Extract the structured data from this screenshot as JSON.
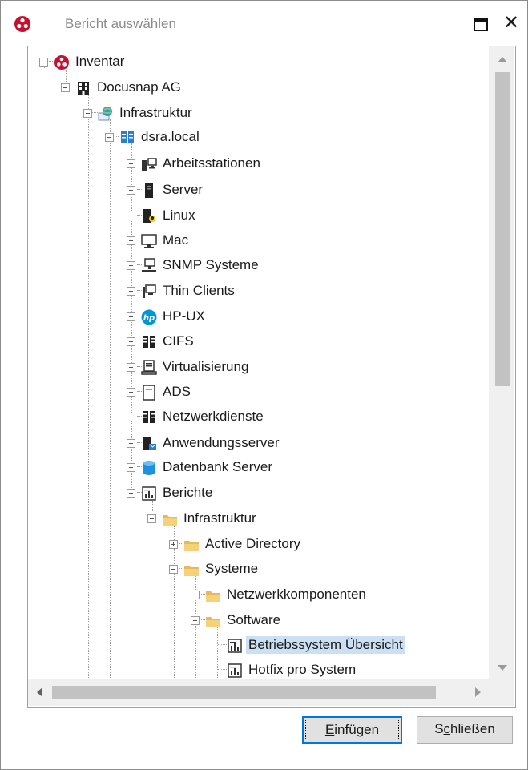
{
  "window": {
    "title": "Bericht auswählen",
    "close_glyph": "✕"
  },
  "tree": {
    "nodes": [
      {
        "label": "Inventar",
        "icon": "docusnap-logo-icon"
      },
      {
        "label": "Docusnap AG",
        "icon": "building-icon"
      },
      {
        "label": "Infrastruktur",
        "icon": "globe-network-icon"
      },
      {
        "label": "dsra.local",
        "icon": "domain-servers-icon"
      },
      {
        "label": "Arbeitsstationen",
        "icon": "workstation-icon"
      },
      {
        "label": "Server",
        "icon": "server-tower-icon"
      },
      {
        "label": "Linux",
        "icon": "linux-server-icon"
      },
      {
        "label": "Mac",
        "icon": "monitor-icon"
      },
      {
        "label": "SNMP Systeme",
        "icon": "snmp-network-icon"
      },
      {
        "label": "Thin Clients",
        "icon": "thin-client-icon"
      },
      {
        "label": "HP-UX",
        "icon": "hp-logo-icon"
      },
      {
        "label": "CIFS",
        "icon": "cifs-servers-icon"
      },
      {
        "label": "Virtualisierung",
        "icon": "virtualization-icon"
      },
      {
        "label": "ADS",
        "icon": "ads-icon"
      },
      {
        "label": "Netzwerkdienste",
        "icon": "network-services-icon"
      },
      {
        "label": "Anwendungsserver",
        "icon": "application-server-icon"
      },
      {
        "label": "Datenbank Server",
        "icon": "database-icon"
      },
      {
        "label": "Berichte",
        "icon": "report-icon"
      },
      {
        "label": "Infrastruktur",
        "icon": "folder-icon"
      },
      {
        "label": "Active Directory",
        "icon": "folder-icon"
      },
      {
        "label": "Systeme",
        "icon": "folder-icon"
      },
      {
        "label": "Netzwerkkomponenten",
        "icon": "folder-icon"
      },
      {
        "label": "Software",
        "icon": "folder-icon"
      },
      {
        "label": "Betriebssystem  Übersicht",
        "icon": "report-icon",
        "selected": true
      },
      {
        "label": "Hotfix pro System",
        "icon": "report-icon"
      }
    ]
  },
  "buttons": {
    "insert": {
      "pre": "",
      "accel": "E",
      "post": "infügen"
    },
    "close": {
      "pre": "S",
      "accel": "c",
      "post": "hließen"
    }
  },
  "colors": {
    "selection": "#cce0f4",
    "default_button_border": "#0078d7",
    "brand_red": "#c8102e",
    "folder": "#e8b85a"
  }
}
